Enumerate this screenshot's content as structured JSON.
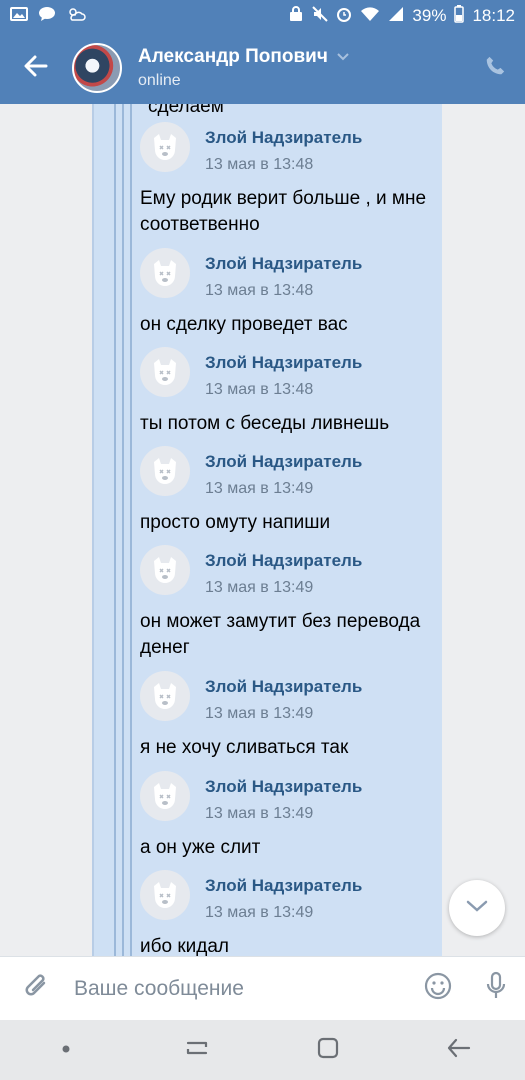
{
  "status_bar": {
    "battery": "39%",
    "time": "18:12"
  },
  "header": {
    "contact_name": "Александр Попович",
    "status": "online"
  },
  "top_text": "сделаем",
  "messages": [
    {
      "author": "Злой Надзиратель",
      "time": "13 мая в 13:48",
      "text": "Ему родик верит больше , и мне соответвенно"
    },
    {
      "author": "Злой Надзиратель",
      "time": "13 мая в 13:48",
      "text": "он сделку проведет вас"
    },
    {
      "author": "Злой Надзиратель",
      "time": "13 мая в 13:48",
      "text": "ты потом с беседы ливнешь"
    },
    {
      "author": "Злой Надзиратель",
      "time": "13 мая в 13:49",
      "text": "просто омуту напиши"
    },
    {
      "author": "Злой Надзиратель",
      "time": "13 мая в 13:49",
      "text": "он может замутит без перевода денег"
    },
    {
      "author": "Злой Надзиратель",
      "time": "13 мая в 13:49",
      "text": "я не хочу сливаться так"
    },
    {
      "author": "Злой Надзиратель",
      "time": "13 мая в 13:49",
      "text": "а он уже слит"
    },
    {
      "author": "Злой Надзиратель",
      "time": "13 мая в 13:49",
      "text": "ибо кидал"
    }
  ],
  "input": {
    "placeholder": "Ваше сообщение"
  },
  "colors": {
    "header": "#5181b8",
    "author": "#2a5885",
    "forward_bg": "#cfe0f4"
  }
}
